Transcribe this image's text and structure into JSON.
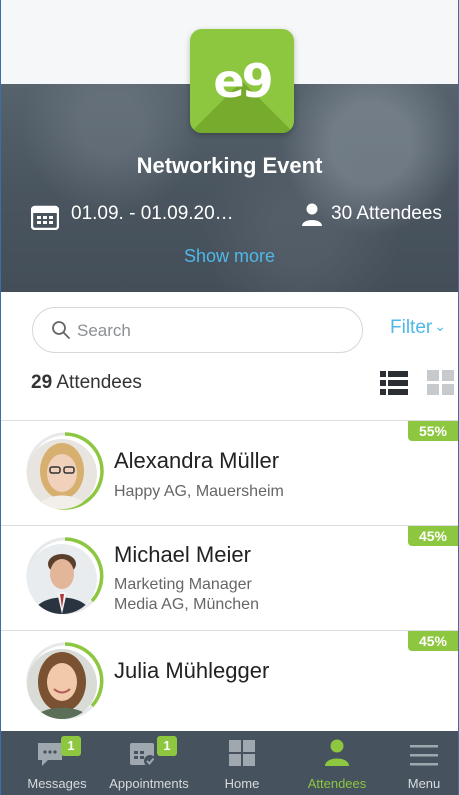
{
  "event": {
    "logo_text": "e9",
    "title": "Networking Event",
    "date": "01.09. - 01.09.20…",
    "attendees_count": "30 Attendees",
    "show_more": "Show more"
  },
  "search": {
    "placeholder": "Search",
    "value": ""
  },
  "filter_label": "Filter",
  "attendee_count_number": "29",
  "attendee_count_label": " Attendees",
  "attendees": [
    {
      "name": "Alexandra Müller",
      "line1": "Happy AG, Mauersheim",
      "line2": "",
      "match": "55%",
      "match_value": 0.55
    },
    {
      "name": "Michael Meier",
      "line1": "Marketing Manager",
      "line2": "Media AG, München",
      "match": "45%",
      "match_value": 0.45
    },
    {
      "name": "Julia Mühlegger",
      "line1": "",
      "line2": "",
      "match": "45%",
      "match_value": 0.45
    }
  ],
  "nav": {
    "messages": {
      "label": "Messages",
      "badge": "1"
    },
    "appointments": {
      "label": "Appointments",
      "badge": "1"
    },
    "home": {
      "label": "Home"
    },
    "attendees": {
      "label": "Attendees"
    },
    "menu": {
      "label": "Menu"
    }
  },
  "colors": {
    "accent": "#8dc63f",
    "link": "#4fb8e8",
    "nav_bg": "#46525d"
  }
}
